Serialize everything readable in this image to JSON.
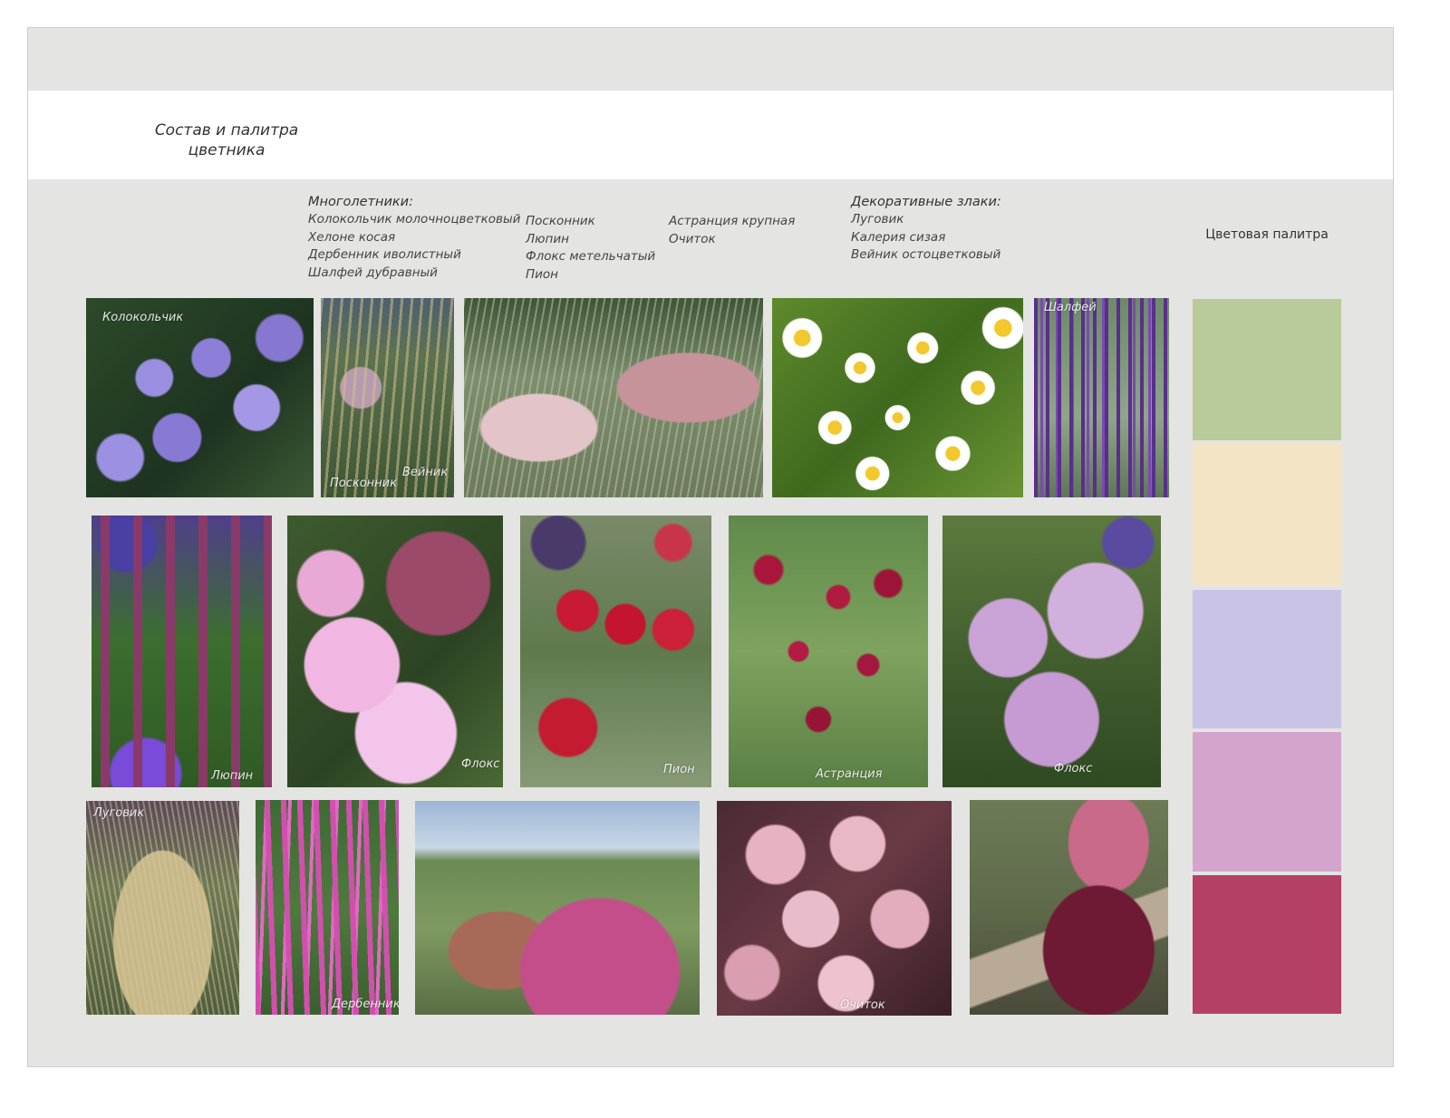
{
  "title": {
    "line1": "Состав и палитра",
    "line2": "цветника"
  },
  "perennials": {
    "heading": "Многолетники:",
    "col1": [
      "Колокольчик молочноцветковый",
      "Хелоне косая",
      "Дербенник иволистный",
      "Шалфей дубравный"
    ],
    "col2": [
      "Посконник",
      "Люпин",
      "Флокс метельчатый",
      "Пион"
    ],
    "col3": [
      "Астранция крупная",
      "Очиток"
    ]
  },
  "grasses": {
    "heading": "Декоративные злаки:",
    "items": [
      "Луговик",
      "Калерия сизая",
      "Вейник остоцветковый"
    ]
  },
  "palette": {
    "title": "Цветовая палитра",
    "colors": [
      "#b9cb9a",
      "#f4e4c6",
      "#c9c4e6",
      "#d3a5cd",
      "#b44066"
    ]
  },
  "photos": {
    "campanula": {
      "label": "Колокольчик"
    },
    "eupatorium": {
      "label": "Посконник",
      "label2": "Вейник"
    },
    "salvia": {
      "label": "Шалфей"
    },
    "lupin": {
      "label": "Люпин"
    },
    "phlox1": {
      "label": "Флокс"
    },
    "peony": {
      "label": "Пион"
    },
    "astrantia": {
      "label": "Астранция"
    },
    "phlox2": {
      "label": "Флокс"
    },
    "deschampsia": {
      "label": "Луговик"
    },
    "lythrum": {
      "label": "Дербенник"
    },
    "sedum": {
      "label": "Очиток"
    }
  }
}
